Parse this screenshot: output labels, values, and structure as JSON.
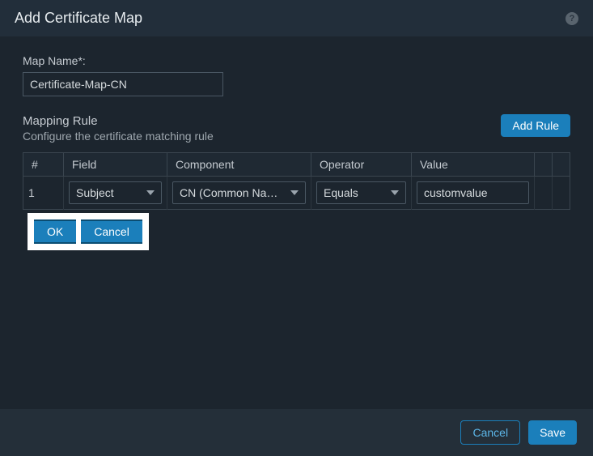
{
  "title": "Add Certificate Map",
  "help_icon": "?",
  "form": {
    "map_name_label": "Map Name*:",
    "map_name_value": "Certificate-Map-CN"
  },
  "section": {
    "title": "Mapping Rule",
    "subtitle": "Configure the certificate matching rule",
    "add_rule_label": "Add Rule"
  },
  "columns": {
    "num": "#",
    "field": "Field",
    "component": "Component",
    "operator": "Operator",
    "value": "Value"
  },
  "row": {
    "num": "1",
    "field": "Subject",
    "component": "CN (Common Name)",
    "operator": "Equals",
    "value": "customvalue"
  },
  "row_actions": {
    "ok": "OK",
    "cancel": "Cancel"
  },
  "footer": {
    "cancel": "Cancel",
    "save": "Save"
  }
}
